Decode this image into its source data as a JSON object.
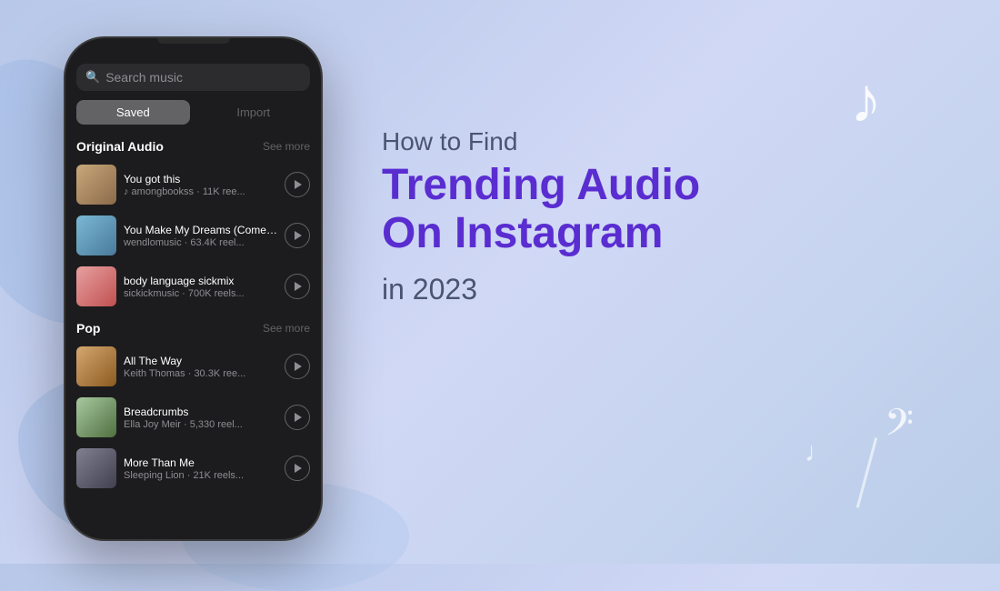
{
  "background": {
    "gradient_start": "#b8c8e8",
    "gradient_end": "#c8d5f0"
  },
  "phone": {
    "search_placeholder": "Search music",
    "tabs": [
      {
        "label": "Saved",
        "active": true
      },
      {
        "label": "Import",
        "active": false
      }
    ],
    "sections": [
      {
        "title": "Original Audio",
        "see_more": "See more",
        "items": [
          {
            "title": "You got this",
            "subtitle": "♪ amongbookss · 11K ree...",
            "thumb_class": "thumb-1"
          },
          {
            "title": "You Make My Dreams (Come Tru...",
            "subtitle": "wendlomusic · 63.4K reel...",
            "thumb_class": "thumb-2"
          },
          {
            "title": "body language sickmix",
            "subtitle": "sickickmusic · 700K reels...",
            "thumb_class": "thumb-3"
          }
        ]
      },
      {
        "title": "Pop",
        "see_more": "See more",
        "items": [
          {
            "title": "All The Way",
            "subtitle": "Keith Thomas · 30.3K ree...",
            "thumb_class": "thumb-4"
          },
          {
            "title": "Breadcrumbs",
            "subtitle": "Ella Joy Meir · 5,330 reel...",
            "thumb_class": "thumb-5"
          },
          {
            "title": "More Than Me",
            "subtitle": "Sleeping Lion · 21K reels...",
            "thumb_class": "thumb-6"
          }
        ]
      }
    ]
  },
  "right": {
    "subtitle": "How to Find",
    "main_title_line1": "Trending Audio",
    "main_title_line2": "On Instagram",
    "year": "in 2023"
  },
  "icons": {
    "music_note": "♩",
    "bass_clef": "𝄢",
    "search_icon": "🔍",
    "play_icon": "▶"
  }
}
